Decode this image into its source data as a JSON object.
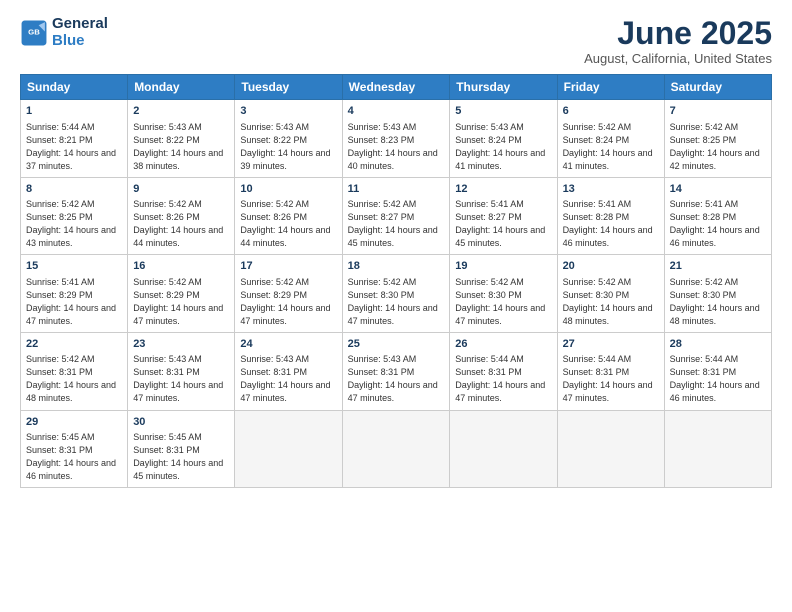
{
  "logo": {
    "line1": "General",
    "line2": "Blue"
  },
  "title": "June 2025",
  "subtitle": "August, California, United States",
  "days_header": [
    "Sunday",
    "Monday",
    "Tuesday",
    "Wednesday",
    "Thursday",
    "Friday",
    "Saturday"
  ],
  "weeks": [
    [
      {
        "num": "1",
        "sunrise": "5:44 AM",
        "sunset": "8:21 PM",
        "daylight": "14 hours and 37 minutes."
      },
      {
        "num": "2",
        "sunrise": "5:43 AM",
        "sunset": "8:22 PM",
        "daylight": "14 hours and 38 minutes."
      },
      {
        "num": "3",
        "sunrise": "5:43 AM",
        "sunset": "8:22 PM",
        "daylight": "14 hours and 39 minutes."
      },
      {
        "num": "4",
        "sunrise": "5:43 AM",
        "sunset": "8:23 PM",
        "daylight": "14 hours and 40 minutes."
      },
      {
        "num": "5",
        "sunrise": "5:43 AM",
        "sunset": "8:24 PM",
        "daylight": "14 hours and 41 minutes."
      },
      {
        "num": "6",
        "sunrise": "5:42 AM",
        "sunset": "8:24 PM",
        "daylight": "14 hours and 41 minutes."
      },
      {
        "num": "7",
        "sunrise": "5:42 AM",
        "sunset": "8:25 PM",
        "daylight": "14 hours and 42 minutes."
      }
    ],
    [
      {
        "num": "8",
        "sunrise": "5:42 AM",
        "sunset": "8:25 PM",
        "daylight": "14 hours and 43 minutes."
      },
      {
        "num": "9",
        "sunrise": "5:42 AM",
        "sunset": "8:26 PM",
        "daylight": "14 hours and 44 minutes."
      },
      {
        "num": "10",
        "sunrise": "5:42 AM",
        "sunset": "8:26 PM",
        "daylight": "14 hours and 44 minutes."
      },
      {
        "num": "11",
        "sunrise": "5:42 AM",
        "sunset": "8:27 PM",
        "daylight": "14 hours and 45 minutes."
      },
      {
        "num": "12",
        "sunrise": "5:41 AM",
        "sunset": "8:27 PM",
        "daylight": "14 hours and 45 minutes."
      },
      {
        "num": "13",
        "sunrise": "5:41 AM",
        "sunset": "8:28 PM",
        "daylight": "14 hours and 46 minutes."
      },
      {
        "num": "14",
        "sunrise": "5:41 AM",
        "sunset": "8:28 PM",
        "daylight": "14 hours and 46 minutes."
      }
    ],
    [
      {
        "num": "15",
        "sunrise": "5:41 AM",
        "sunset": "8:29 PM",
        "daylight": "14 hours and 47 minutes."
      },
      {
        "num": "16",
        "sunrise": "5:42 AM",
        "sunset": "8:29 PM",
        "daylight": "14 hours and 47 minutes."
      },
      {
        "num": "17",
        "sunrise": "5:42 AM",
        "sunset": "8:29 PM",
        "daylight": "14 hours and 47 minutes."
      },
      {
        "num": "18",
        "sunrise": "5:42 AM",
        "sunset": "8:30 PM",
        "daylight": "14 hours and 47 minutes."
      },
      {
        "num": "19",
        "sunrise": "5:42 AM",
        "sunset": "8:30 PM",
        "daylight": "14 hours and 47 minutes."
      },
      {
        "num": "20",
        "sunrise": "5:42 AM",
        "sunset": "8:30 PM",
        "daylight": "14 hours and 48 minutes."
      },
      {
        "num": "21",
        "sunrise": "5:42 AM",
        "sunset": "8:30 PM",
        "daylight": "14 hours and 48 minutes."
      }
    ],
    [
      {
        "num": "22",
        "sunrise": "5:42 AM",
        "sunset": "8:31 PM",
        "daylight": "14 hours and 48 minutes."
      },
      {
        "num": "23",
        "sunrise": "5:43 AM",
        "sunset": "8:31 PM",
        "daylight": "14 hours and 47 minutes."
      },
      {
        "num": "24",
        "sunrise": "5:43 AM",
        "sunset": "8:31 PM",
        "daylight": "14 hours and 47 minutes."
      },
      {
        "num": "25",
        "sunrise": "5:43 AM",
        "sunset": "8:31 PM",
        "daylight": "14 hours and 47 minutes."
      },
      {
        "num": "26",
        "sunrise": "5:44 AM",
        "sunset": "8:31 PM",
        "daylight": "14 hours and 47 minutes."
      },
      {
        "num": "27",
        "sunrise": "5:44 AM",
        "sunset": "8:31 PM",
        "daylight": "14 hours and 47 minutes."
      },
      {
        "num": "28",
        "sunrise": "5:44 AM",
        "sunset": "8:31 PM",
        "daylight": "14 hours and 46 minutes."
      }
    ],
    [
      {
        "num": "29",
        "sunrise": "5:45 AM",
        "sunset": "8:31 PM",
        "daylight": "14 hours and 46 minutes."
      },
      {
        "num": "30",
        "sunrise": "5:45 AM",
        "sunset": "8:31 PM",
        "daylight": "14 hours and 45 minutes."
      },
      null,
      null,
      null,
      null,
      null
    ]
  ]
}
